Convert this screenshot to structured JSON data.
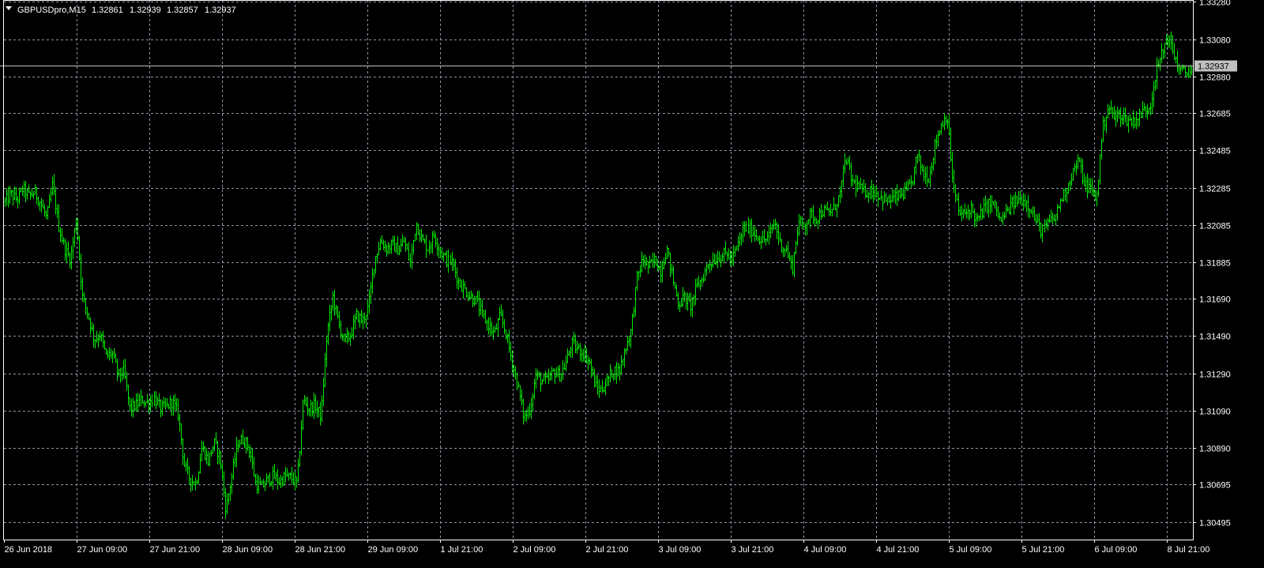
{
  "chart_header": {
    "symbol": "GBPUSDpro,M15",
    "open": "1.32861",
    "high": "1.32939",
    "low": "1.32857",
    "close": "1.32937"
  },
  "colors": {
    "background": "#000000",
    "grid": "#8c96aa",
    "bars": "#00ee00",
    "axis": "#ffffff",
    "price_line": "#c0c0c0"
  },
  "chart_data": {
    "type": "line",
    "symbol": "GBPUSDpro",
    "timeframe": "M15",
    "ylim": [
      1.304,
      1.3329
    ],
    "grid": true,
    "current_price": 1.32937,
    "y_ticks": [
      "1.33280",
      "1.33080",
      "1.32880",
      "1.32685",
      "1.32485",
      "1.32285",
      "1.32085",
      "1.31885",
      "1.31690",
      "1.31490",
      "1.31290",
      "1.31090",
      "1.30890",
      "1.30695",
      "1.30495"
    ],
    "x_ticks": [
      "26 Jun 2018",
      "27 Jun 09:00",
      "27 Jun 21:00",
      "28 Jun 09:00",
      "28 Jun 21:00",
      "29 Jun 09:00",
      "1 Jul 21:00",
      "2 Jul 09:00",
      "2 Jul 21:00",
      "3 Jul 09:00",
      "3 Jul 21:00",
      "4 Jul 09:00",
      "4 Jul 21:00",
      "5 Jul 09:00",
      "5 Jul 21:00",
      "6 Jul 09:00",
      "8 Jul 21:00"
    ],
    "series": [
      {
        "values": [
          1.3221,
          1.3225,
          1.3222,
          1.3228,
          1.3224,
          1.3226,
          1.322,
          1.3212,
          1.323,
          1.3208,
          1.3196,
          1.319,
          1.3212,
          1.317,
          1.316,
          1.3147,
          1.315,
          1.3138,
          1.314,
          1.3128,
          1.313,
          1.311,
          1.3112,
          1.3115,
          1.3113,
          1.3116,
          1.311,
          1.3111,
          1.3114,
          1.3107,
          1.308,
          1.3072,
          1.307,
          1.309,
          1.3082,
          1.3092,
          1.3084,
          1.3056,
          1.3074,
          1.3092,
          1.3094,
          1.3088,
          1.307,
          1.3068,
          1.3072,
          1.3074,
          1.3071,
          1.3074,
          1.3073,
          1.307,
          1.3115,
          1.311,
          1.3112,
          1.3106,
          1.315,
          1.317,
          1.3155,
          1.3146,
          1.315,
          1.316,
          1.3157,
          1.3165,
          1.319,
          1.32,
          1.3196,
          1.3198,
          1.3195,
          1.32,
          1.3188,
          1.321,
          1.32,
          1.3196,
          1.3203,
          1.3195,
          1.319,
          1.3188,
          1.3178,
          1.3174,
          1.317,
          1.3168,
          1.316,
          1.3155,
          1.315,
          1.316,
          1.315,
          1.3135,
          1.3122,
          1.3105,
          1.311,
          1.3128,
          1.3125,
          1.3125,
          1.313,
          1.3128,
          1.3134,
          1.3145,
          1.3142,
          1.314,
          1.3135,
          1.3122,
          1.312,
          1.3125,
          1.3131,
          1.313,
          1.3142,
          1.3152,
          1.318,
          1.319,
          1.3186,
          1.319,
          1.3184,
          1.3196,
          1.318,
          1.3166,
          1.317,
          1.3165,
          1.3175,
          1.318,
          1.3188,
          1.319,
          1.3192,
          1.3193,
          1.319,
          1.3198,
          1.3207,
          1.3206,
          1.3203,
          1.32,
          1.3202,
          1.321,
          1.3198,
          1.3195,
          1.3185,
          1.321,
          1.3208,
          1.3214,
          1.3212,
          1.3216,
          1.3215,
          1.3217,
          1.3225,
          1.3245,
          1.3232,
          1.3229,
          1.3226,
          1.3227,
          1.3226,
          1.3223,
          1.3221,
          1.3223,
          1.3224,
          1.3226,
          1.323,
          1.3246,
          1.3236,
          1.3234,
          1.3252,
          1.3262,
          1.3268,
          1.323,
          1.3215,
          1.3214,
          1.3218,
          1.321,
          1.3216,
          1.322,
          1.3219,
          1.321,
          1.3215,
          1.322,
          1.3222,
          1.3222,
          1.3218,
          1.321,
          1.3205,
          1.321,
          1.3212,
          1.3222,
          1.3228,
          1.3237,
          1.3243,
          1.323,
          1.3228,
          1.3222,
          1.326,
          1.3272,
          1.3266,
          1.3268,
          1.3265,
          1.3264,
          1.3266,
          1.327,
          1.3272,
          1.329,
          1.33,
          1.331,
          1.33,
          1.3291,
          1.329,
          1.3291
        ]
      }
    ]
  }
}
